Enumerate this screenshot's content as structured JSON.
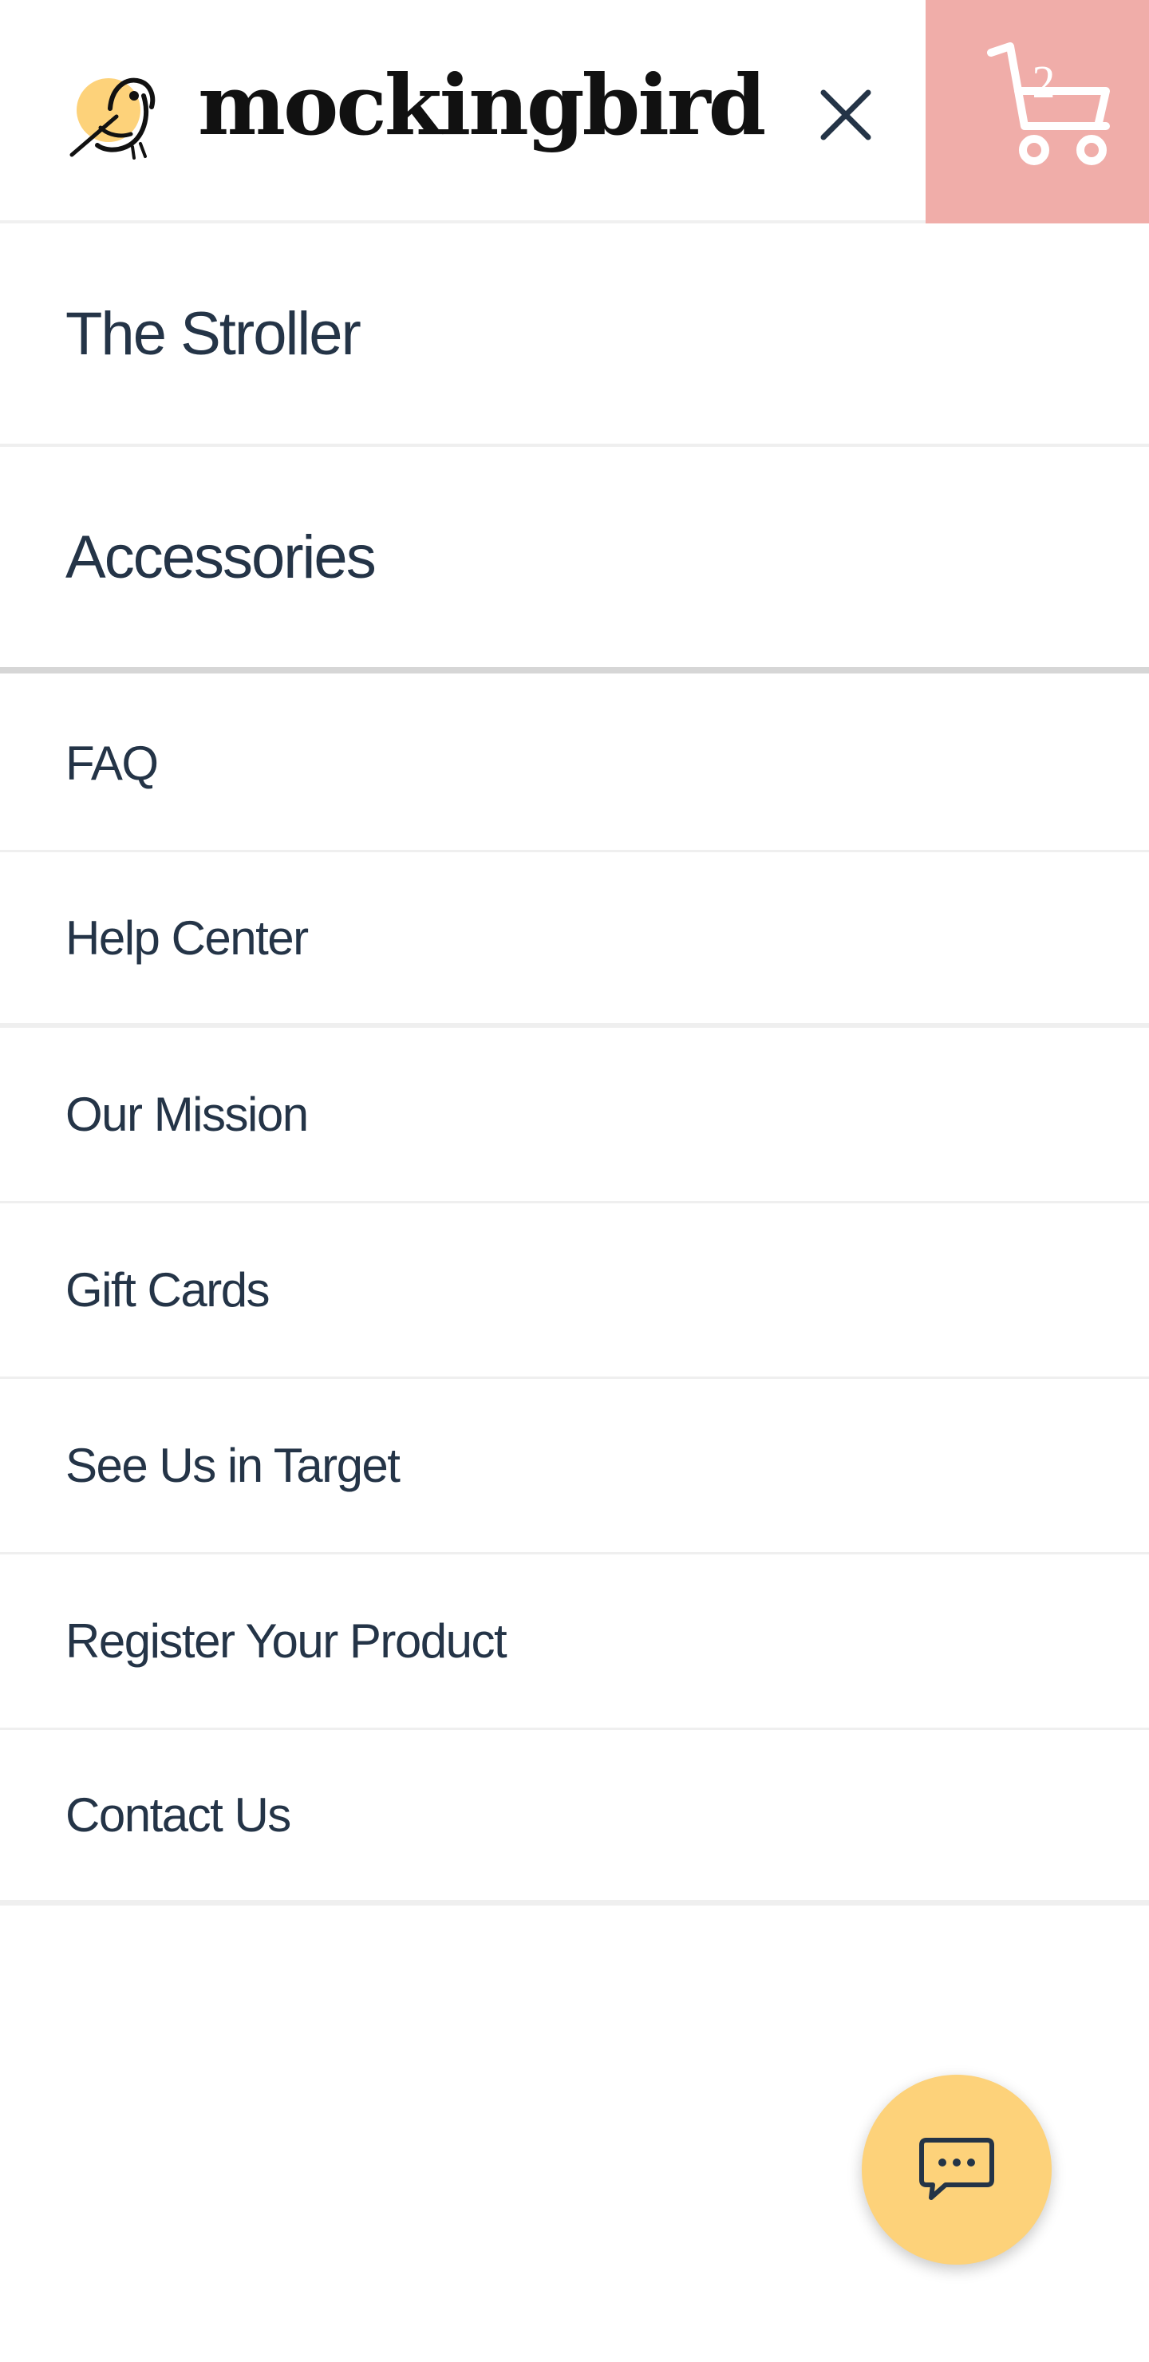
{
  "header": {
    "brand": "mockingbird",
    "logo_icon": "mockingbird-logo-icon",
    "close_icon": "close-icon",
    "cart_icon": "cart-icon",
    "cart_count": "2"
  },
  "primary_nav": {
    "items": [
      {
        "label": "The Stroller"
      },
      {
        "label": "Accessories"
      }
    ]
  },
  "secondary_nav": {
    "items": [
      {
        "label": "FAQ"
      },
      {
        "label": "Help Center"
      },
      {
        "label": "Our Mission"
      },
      {
        "label": "Gift Cards"
      },
      {
        "label": "See Us in Target"
      },
      {
        "label": "Register Your Product"
      },
      {
        "label": "Contact Us"
      }
    ]
  },
  "chat": {
    "icon": "chat-bubble-icon"
  },
  "colors": {
    "cart_background": "#f0ada9",
    "chat_background": "#fdd27a",
    "logo_accent": "#fdd27a",
    "text": "#243447"
  }
}
